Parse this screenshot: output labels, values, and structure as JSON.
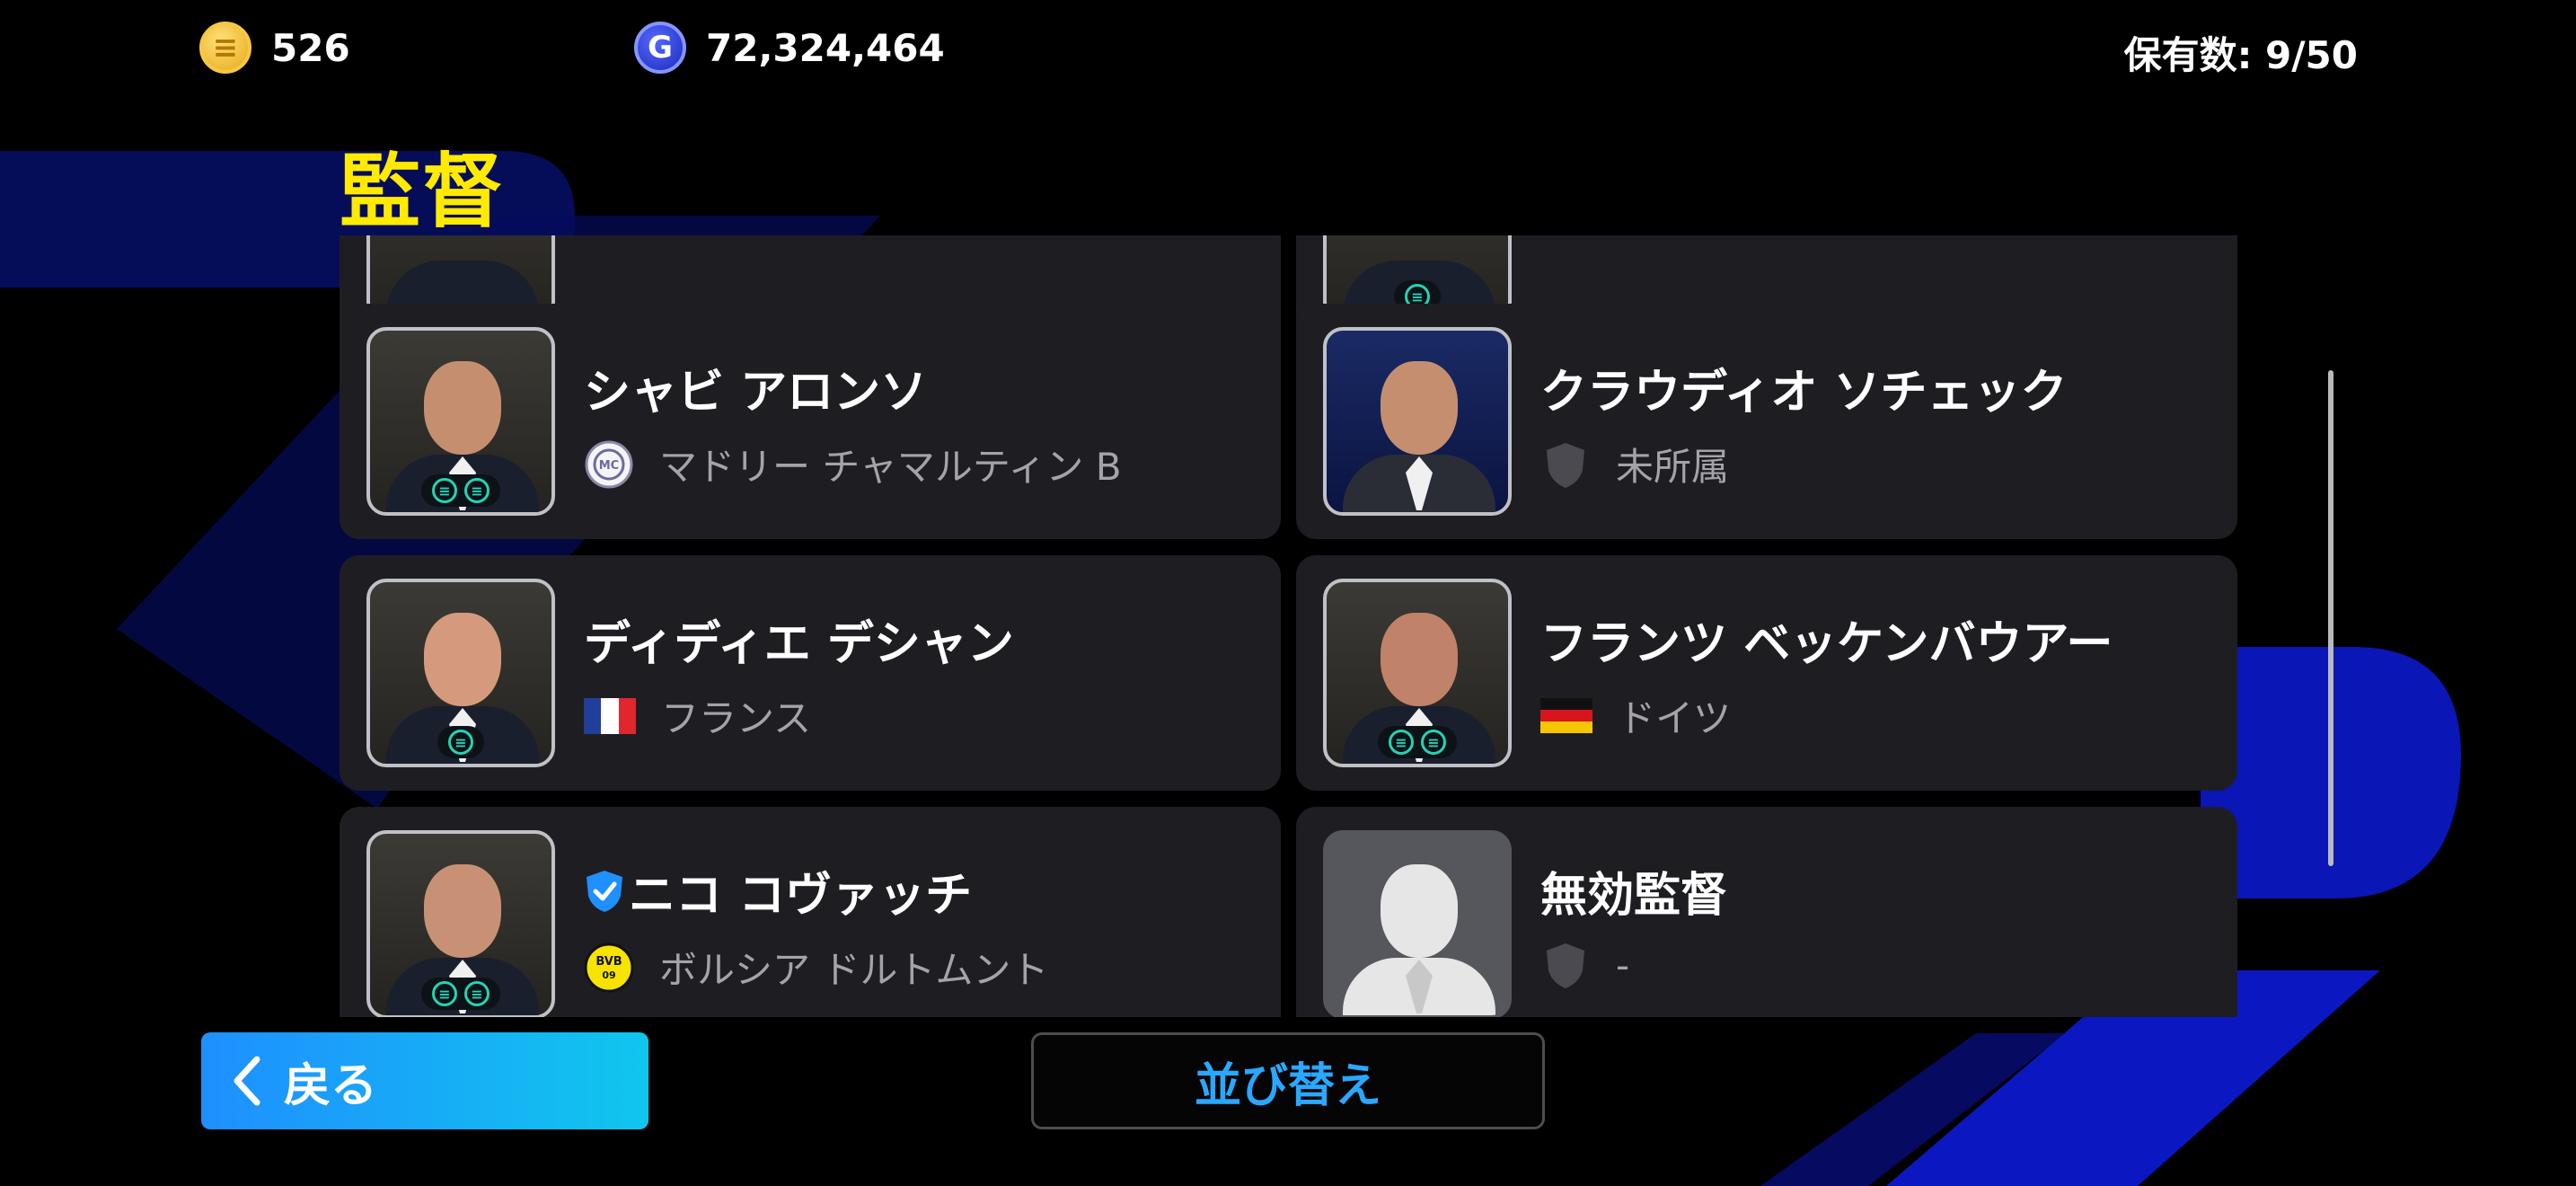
{
  "topbar": {
    "coins": {
      "icon": "e-coin-icon",
      "value": "526"
    },
    "gp": {
      "icon": "gp-coin-icon",
      "value": "72,324,464"
    },
    "holdings": "保有数: 9/50"
  },
  "page_title": "監督",
  "managers": [
    {
      "name": "シャビ アロンソ",
      "team": "マドリー チャマルティン B",
      "team_icon": "club-crest-icon",
      "verified": false
    },
    {
      "name": "クラウディオ ソチェック",
      "team": "未所属",
      "team_icon": "empty-shield-icon",
      "verified": false
    },
    {
      "name": "ディディエ デシャン",
      "team": "フランス",
      "team_icon": "france-flag-icon",
      "verified": false
    },
    {
      "name": "フランツ ベッケンバウアー",
      "team": "ドイツ",
      "team_icon": "germany-flag-icon",
      "verified": false
    },
    {
      "name": "ニコ コヴァッチ",
      "team": "ボルシア ドルトムント",
      "team_icon": "bvb-crest-icon",
      "verified": true
    },
    {
      "name": "無効監督",
      "team": "-",
      "team_icon": "empty-shield-icon",
      "verified": false
    }
  ],
  "buttons": {
    "back": "戻る",
    "sort": "並び替え"
  },
  "colors": {
    "title": "#ffea00",
    "back_button": "#1f8fff",
    "sort_text": "#2aa8ff",
    "card_bg": "#1e1e22",
    "accent_bg": "#0a0f9e"
  }
}
